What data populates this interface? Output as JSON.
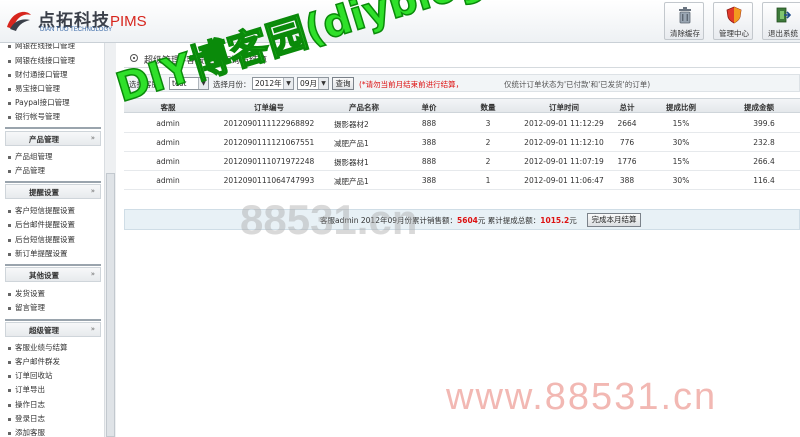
{
  "header": {
    "logo_text": "点拓科技",
    "logo_suffix": "PIMS",
    "logo_sub": "DIAN TUO TECHNOLOGY",
    "buttons": [
      {
        "label": "清除缓存",
        "icon": "trash-icon"
      },
      {
        "label": "管理中心",
        "icon": "shield-icon"
      },
      {
        "label": "退出系统",
        "icon": "exit-icon"
      }
    ]
  },
  "sidebar": {
    "top_items": [
      "网银在线接口管理",
      "财付通接口管理",
      "易宝接口管理",
      "Paypal接口管理",
      "银行帐号管理"
    ],
    "sections": [
      {
        "title": "产品管理",
        "items": [
          "产品组管理",
          "产品管理"
        ]
      },
      {
        "title": "提醒设置",
        "items": [
          "客户短信提醒设置",
          "后台邮件提醒设置",
          "后台短信提醒设置",
          "新订单提醒设置"
        ]
      },
      {
        "title": "其他设置",
        "items": [
          "发货设置",
          "留言管理"
        ]
      },
      {
        "title": "超级管理",
        "items": [
          "客服业绩与结算",
          "客户邮件群发",
          "订单回收站",
          "订单导出",
          "操作日志",
          "登录日志",
          "添加客服"
        ]
      }
    ]
  },
  "main": {
    "title": "超级管理 -客服业绩查询与结算",
    "filter": {
      "label_staff": "选择客服：",
      "staff_value": "test",
      "label_month": "选择月份：",
      "year_value": "2012年",
      "month_value": "09月",
      "query_button": "查询",
      "warning": "(*请勿当前月结束前进行结算，",
      "note": "仅统计订单状态为'已付款'和'已发货'的订单)"
    },
    "table": {
      "columns": [
        "客服",
        "订单编号",
        "产品名称",
        "单价",
        "数量",
        "订单时间",
        "总计",
        "提成比例",
        "提成金额"
      ],
      "rows": [
        [
          "admin",
          "2012090111122968892",
          "摄影器材2",
          "888",
          "3",
          "2012-09-01 11:12:29",
          "2664",
          "15%",
          "399.6"
        ],
        [
          "admin",
          "2012090111121067551",
          "减肥产品1",
          "388",
          "2",
          "2012-09-01 11:12:10",
          "776",
          "30%",
          "232.8"
        ],
        [
          "admin",
          "2012090111071972248",
          "摄影器材1",
          "888",
          "2",
          "2012-09-01 11:07:19",
          "1776",
          "15%",
          "266.4"
        ],
        [
          "admin",
          "2012090111064747993",
          "减肥产品1",
          "388",
          "1",
          "2012-09-01 11:06:47",
          "388",
          "30%",
          "116.4"
        ]
      ]
    },
    "summary": {
      "prefix": "客服admin 2012年09月份累计销售额：",
      "sales": "5604",
      "unit1": "元  累计提成总额：",
      "commission": "1015.2",
      "unit2": "元",
      "button": "完成本月结算"
    }
  },
  "watermarks": {
    "blog": "DIY博客园(diybloghome.com)",
    "site_mid": "88531.cn",
    "site_br": "www.88531.cn"
  },
  "colors": {
    "warning_red": "#dd1111",
    "watermark_green": "#2fe02a",
    "watermark_pink": "#f2b8b3"
  }
}
